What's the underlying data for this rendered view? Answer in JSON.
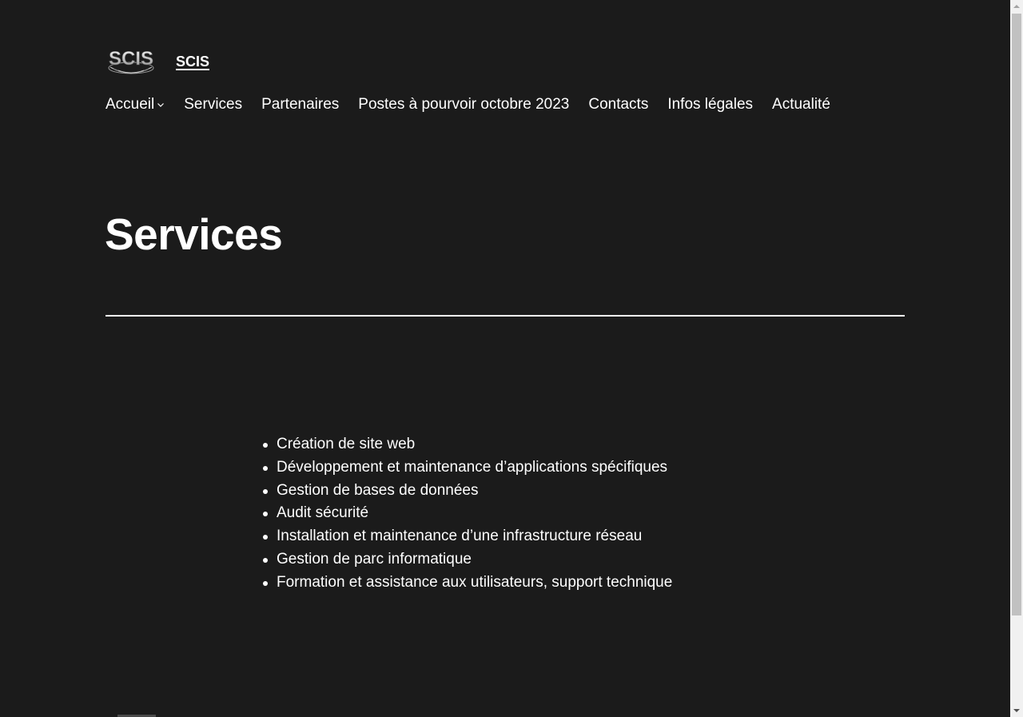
{
  "site": {
    "logo_text": "SCIS",
    "title": "SCIS"
  },
  "nav": {
    "items": [
      {
        "label": "Accueil",
        "has_submenu": true
      },
      {
        "label": "Services",
        "has_submenu": false
      },
      {
        "label": "Partenaires",
        "has_submenu": false
      },
      {
        "label": "Postes à pourvoir octobre 2023",
        "has_submenu": false
      },
      {
        "label": "Contacts",
        "has_submenu": false
      },
      {
        "label": "Infos légales",
        "has_submenu": false
      },
      {
        "label": "Actualité",
        "has_submenu": false
      }
    ]
  },
  "main": {
    "page_title": "Services",
    "services": [
      "Création de site web",
      "Développement et maintenance d’applications spécifiques",
      "Gestion de bases de données",
      "Audit sécurité",
      "Installation et maintenance d’une infrastructure réseau",
      "Gestion de parc informatique",
      "Formation et assistance aux utilisateurs, support technique"
    ]
  },
  "colors": {
    "background": "#1b1b1b",
    "text": "#ffffff",
    "scrollbar_track": "#f1f1f1",
    "scrollbar_thumb": "#c1c1c1"
  }
}
